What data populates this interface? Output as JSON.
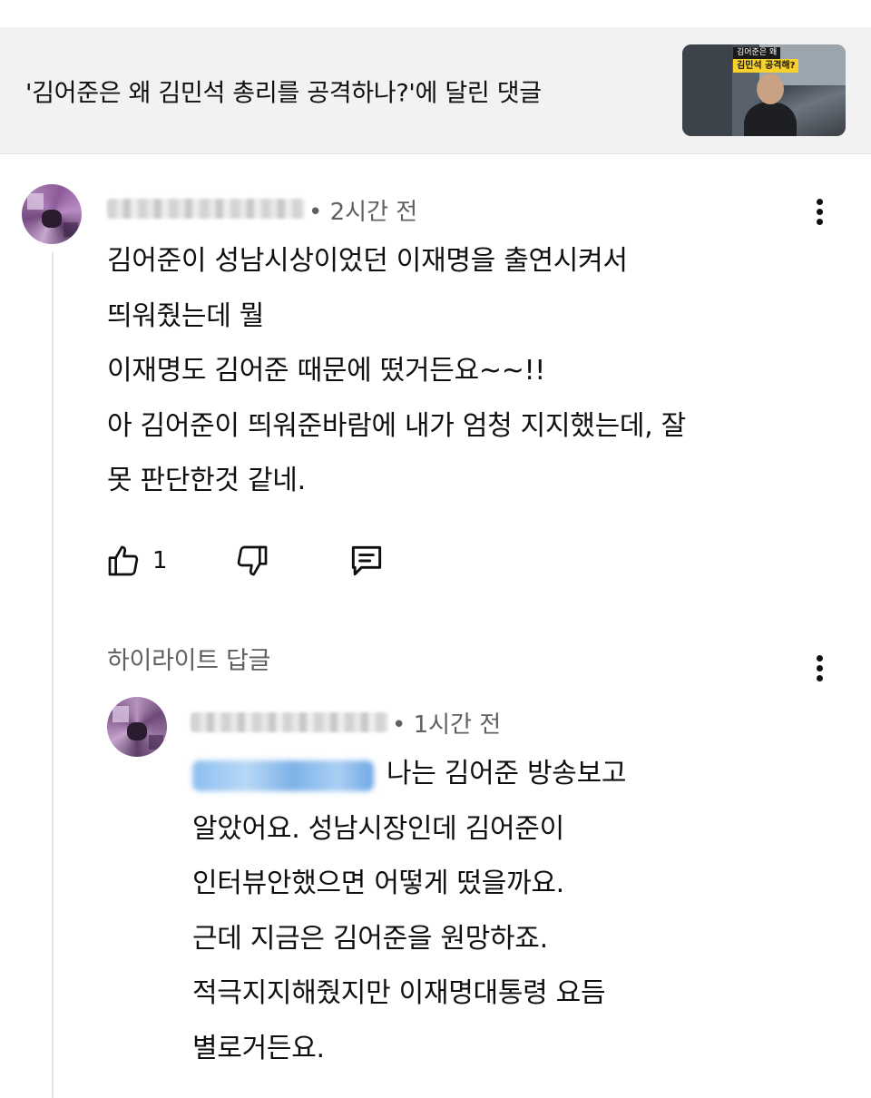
{
  "header": {
    "title": "'김어준은 왜 김민석 총리를 공격하나?'에 달린 댓글",
    "thumbnail": {
      "tag_line1": "김어준은 왜",
      "tag_line2": "김민석 공격해?"
    }
  },
  "comment": {
    "time": "• 2시간 전",
    "lines": [
      "김어준이 성남시상이었던 이재명을 출연시켜서",
      "띄워줬는데 뭘",
      "이재명도 김어준 때문에 떴거든요~~!!",
      "아 김어준이 띄워준바람에 내가 엄청 지지했는데, 잘",
      "못 판단한것 같네."
    ],
    "like_count": "1"
  },
  "highlight_label": "하이라이트 답글",
  "reply": {
    "time": "• 1시간 전",
    "lines": [
      "나는 김어준 방송보고",
      "알았어요. 성남시장인데 김어준이",
      "인터뷰안했으면 어떻게 떴을까요.",
      "근데 지금은 김어준을 원망하죠.",
      "적극지지해줬지만 이재명대통령 요듬",
      "별로거든요."
    ]
  },
  "icons": {
    "like": "thumbs-up-icon",
    "dislike": "thumbs-down-icon",
    "reply": "comment-reply-icon",
    "more": "more-vertical-icon"
  }
}
